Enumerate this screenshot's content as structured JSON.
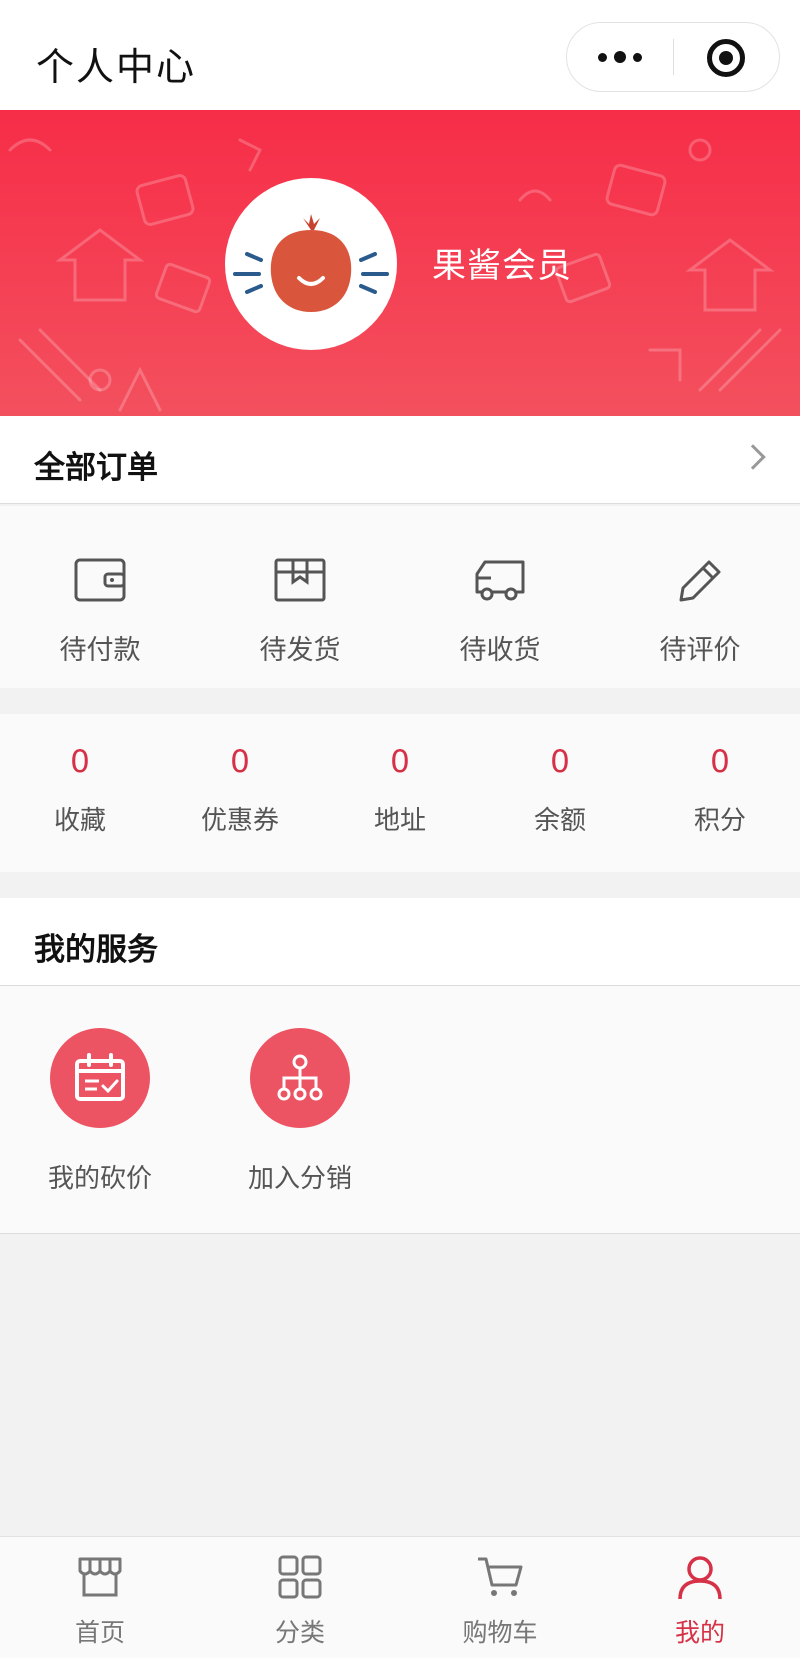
{
  "title_bar": {
    "title": "个人中心",
    "more_icon": "more-dots-icon",
    "close_icon": "target-close-icon"
  },
  "profile": {
    "member_name": "果酱会员",
    "avatar_icon": "pomegranate-icon"
  },
  "orders": {
    "header": "全部订单",
    "items": [
      {
        "label": "待付款",
        "icon": "wallet-icon"
      },
      {
        "label": "待发货",
        "icon": "box-icon"
      },
      {
        "label": "待收货",
        "icon": "truck-icon"
      },
      {
        "label": "待评价",
        "icon": "pencil-icon"
      }
    ]
  },
  "stats": [
    {
      "value": "0",
      "label": "收藏"
    },
    {
      "value": "0",
      "label": "优惠券"
    },
    {
      "value": "0",
      "label": "地址"
    },
    {
      "value": "0",
      "label": "余额"
    },
    {
      "value": "0",
      "label": "积分"
    }
  ],
  "services": {
    "header": "我的服务",
    "items": [
      {
        "label": "我的砍价",
        "icon": "calendar-check-icon"
      },
      {
        "label": "加入分销",
        "icon": "network-icon"
      }
    ]
  },
  "tabbar": [
    {
      "label": "首页",
      "icon": "store-icon",
      "active": false
    },
    {
      "label": "分类",
      "icon": "grid-icon",
      "active": false
    },
    {
      "label": "购物车",
      "icon": "cart-icon",
      "active": false
    },
    {
      "label": "我的",
      "icon": "user-icon",
      "active": true
    }
  ],
  "colors": {
    "accent": "#d63146",
    "banner_top": "#f72d48",
    "banner_bottom": "#f3505e",
    "service_circle": "#ec5363"
  }
}
